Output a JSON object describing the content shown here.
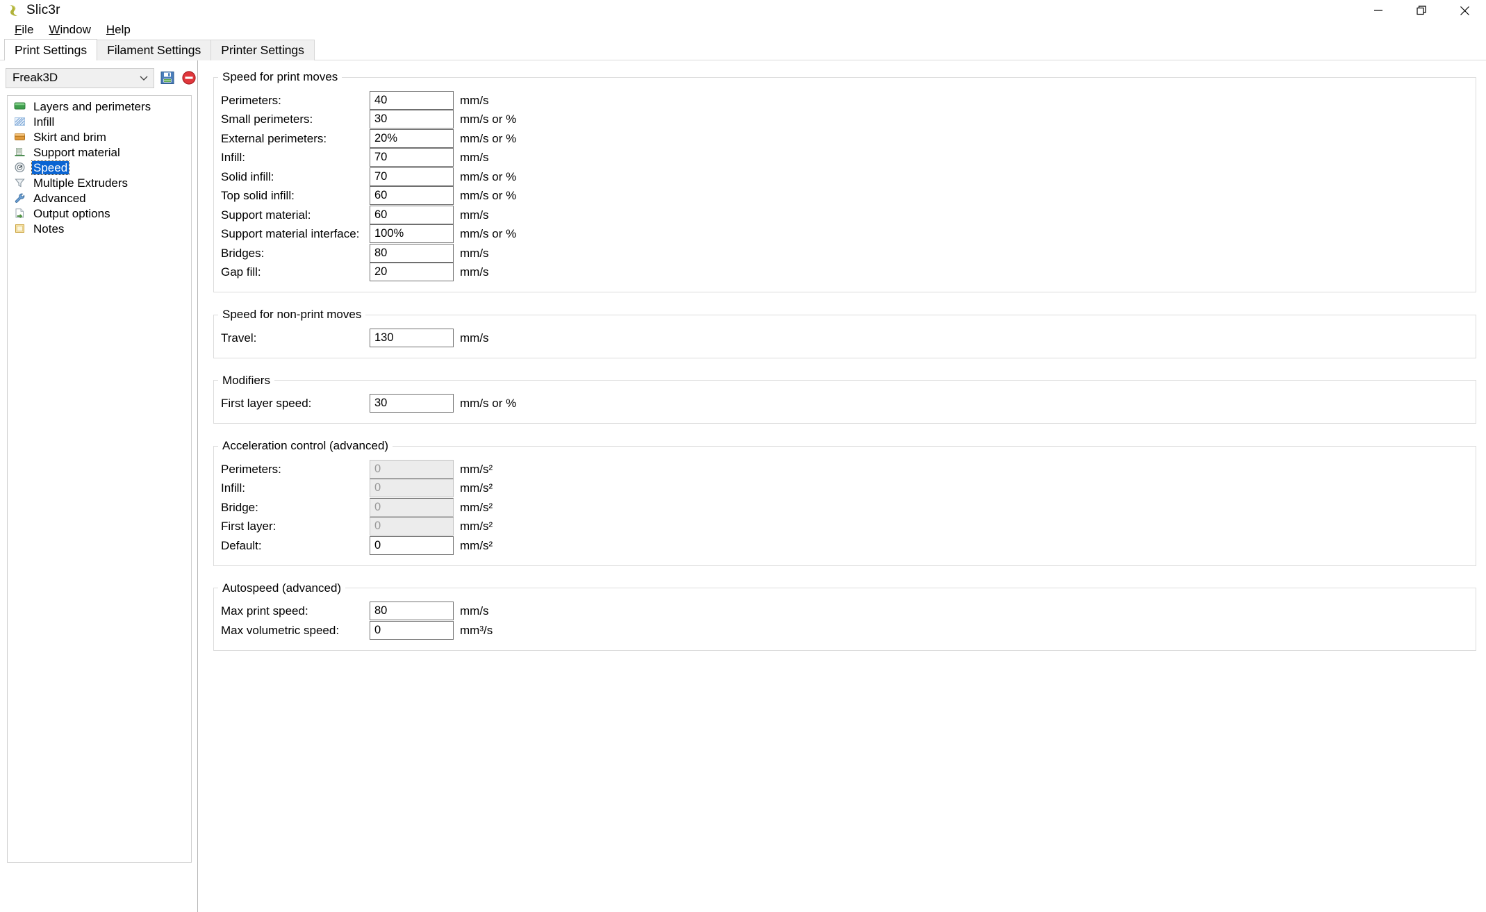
{
  "window": {
    "title": "Slic3r",
    "icon": "slic3r-logo-icon",
    "controls": [
      {
        "name": "minimize-button",
        "glyph": "minimize-icon",
        "label": "Minimize"
      },
      {
        "name": "restore-button",
        "glyph": "restore-icon",
        "label": "Restore"
      },
      {
        "name": "close-button",
        "glyph": "close-icon",
        "label": "Close"
      }
    ]
  },
  "menubar": {
    "items": [
      {
        "label": "File",
        "mnemonic": "F"
      },
      {
        "label": "Window",
        "mnemonic": "W"
      },
      {
        "label": "Help",
        "mnemonic": "H"
      }
    ]
  },
  "tabs": [
    {
      "label": "Print Settings",
      "active": true
    },
    {
      "label": "Filament Settings",
      "active": false
    },
    {
      "label": "Printer Settings",
      "active": false
    }
  ],
  "sidebar": {
    "preset": {
      "value": "Freak3D",
      "dropdown_icon": "chevron-down-icon",
      "save_icon": "save-preset-icon",
      "delete_icon": "delete-preset-icon"
    },
    "items": [
      {
        "label": "Layers and perimeters",
        "icon": "layers-icon",
        "selected": false
      },
      {
        "label": "Infill",
        "icon": "infill-icon",
        "selected": false
      },
      {
        "label": "Skirt and brim",
        "icon": "skirt-brim-icon",
        "selected": false
      },
      {
        "label": "Support material",
        "icon": "support-material-icon",
        "selected": false
      },
      {
        "label": "Speed",
        "icon": "speed-icon",
        "selected": true
      },
      {
        "label": "Multiple Extruders",
        "icon": "multiple-extruders-icon",
        "selected": false
      },
      {
        "label": "Advanced",
        "icon": "advanced-wrench-icon",
        "selected": false
      },
      {
        "label": "Output options",
        "icon": "output-options-icon",
        "selected": false
      },
      {
        "label": "Notes",
        "icon": "notes-icon",
        "selected": false
      }
    ]
  },
  "groups": [
    {
      "title": "Speed for print moves",
      "rows": [
        {
          "label": "Perimeters:",
          "value": "40",
          "unit": "mm/s",
          "disabled": false
        },
        {
          "label": "Small perimeters:",
          "value": "30",
          "unit": "mm/s or %",
          "disabled": false
        },
        {
          "label": "External perimeters:",
          "value": "20%",
          "unit": "mm/s or %",
          "disabled": false
        },
        {
          "label": "Infill:",
          "value": "70",
          "unit": "mm/s",
          "disabled": false
        },
        {
          "label": "Solid infill:",
          "value": "70",
          "unit": "mm/s or %",
          "disabled": false
        },
        {
          "label": "Top solid infill:",
          "value": "60",
          "unit": "mm/s or %",
          "disabled": false
        },
        {
          "label": "Support material:",
          "value": "60",
          "unit": "mm/s",
          "disabled": false
        },
        {
          "label": "Support material interface:",
          "value": "100%",
          "unit": "mm/s or %",
          "disabled": false
        },
        {
          "label": "Bridges:",
          "value": "80",
          "unit": "mm/s",
          "disabled": false
        },
        {
          "label": "Gap fill:",
          "value": "20",
          "unit": "mm/s",
          "disabled": false
        }
      ]
    },
    {
      "title": "Speed for non-print moves",
      "rows": [
        {
          "label": "Travel:",
          "value": "130",
          "unit": "mm/s",
          "disabled": false
        }
      ]
    },
    {
      "title": "Modifiers",
      "rows": [
        {
          "label": "First layer speed:",
          "value": "30",
          "unit": "mm/s or %",
          "disabled": false
        }
      ]
    },
    {
      "title": "Acceleration control (advanced)",
      "rows": [
        {
          "label": "Perimeters:",
          "value": "0",
          "unit": "mm/s²",
          "disabled": true
        },
        {
          "label": "Infill:",
          "value": "0",
          "unit": "mm/s²",
          "disabled": true
        },
        {
          "label": "Bridge:",
          "value": "0",
          "unit": "mm/s²",
          "disabled": true
        },
        {
          "label": "First layer:",
          "value": "0",
          "unit": "mm/s²",
          "disabled": true
        },
        {
          "label": "Default:",
          "value": "0",
          "unit": "mm/s²",
          "disabled": false
        }
      ]
    },
    {
      "title": "Autospeed (advanced)",
      "rows": [
        {
          "label": "Max print speed:",
          "value": "80",
          "unit": "mm/s",
          "disabled": false
        },
        {
          "label": "Max volumetric speed:",
          "value": "0",
          "unit": "mm³/s",
          "disabled": false
        }
      ]
    }
  ],
  "colors": {
    "selection_blue": "#0a64d2",
    "window_bg": "#ffffff",
    "tab_inactive": "#f0f0f0",
    "group_border": "#dcdcdc",
    "field_border": "#6f6f6f",
    "disabled_bg": "#ececec",
    "delete_red": "#e0373c",
    "save_blue": "#4a7ebb"
  }
}
